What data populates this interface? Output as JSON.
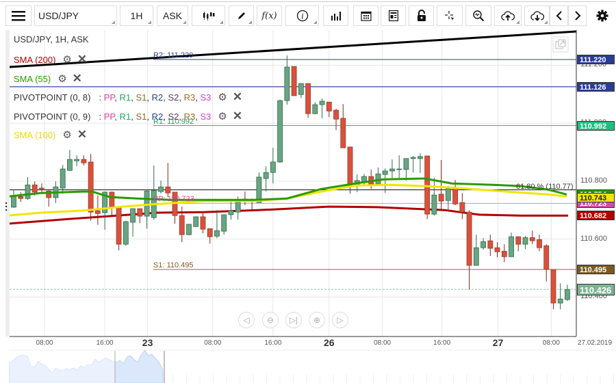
{
  "toolbar": {
    "symbol": "USD/JPY",
    "interval": "1H",
    "price_type": "ASK",
    "fx_label": "f(x)",
    "icons": [
      "hamburger-menu-icon",
      "candlestick-type-icon",
      "pencil-draw-icon",
      "function-icon",
      "info-icon",
      "bar-chart-icon",
      "calendar-icon",
      "news-icon",
      "unlock-icon",
      "crosshair-icon",
      "zoom-search-icon",
      "upload-cloud-icon",
      "download-cloud-icon",
      "chevron-left-icon",
      "chevron-right-icon",
      "gear-icon"
    ]
  },
  "legend": {
    "title": "USD/JPY, 1H, ASK",
    "sma200": "SMA (200)",
    "sma55": "SMA (55)",
    "pivot1": "PIVOTPOINT (0, 8)",
    "pivot2": "PIVOTPOINT (0, 9)",
    "sma100": "SMA (100)",
    "pivot_sep": ":",
    "pivot_parts": [
      "PP",
      "R1",
      "S1",
      "R2",
      "S2",
      "R3",
      "S3"
    ],
    "pivot_colors": [
      "#d63fa6",
      "#1aa86b",
      "#8a6d2a",
      "#2a3d8f",
      "#5a3a5a",
      "#9a6a2a",
      "#d63fd6"
    ]
  },
  "colors": {
    "up": "#6aa583",
    "down": "#d9513c",
    "sma200": "#b00000",
    "sma55": "#2b9a00",
    "sma100": "#f0e600",
    "r2": "#2a3d8f",
    "r1": "#1ec080",
    "pp": "#d68fc8",
    "s1": "#8a6d2a",
    "fib": "#333333",
    "current": "#6aa583"
  },
  "levels": {
    "r2_label": "R2: 111.220",
    "r1_label": "R1: 110.992",
    "pp_label": "PP: 110.723",
    "s1_label": "S1: 110.495",
    "fib_label": "61.80 % (110.77)"
  },
  "price_axis": {
    "badges": [
      {
        "text": "111.220",
        "value": 111.22,
        "color": "#2a3d8f"
      },
      {
        "text": "111.126",
        "value": 111.126,
        "color": "#2a3d8f"
      },
      {
        "text": "110.992",
        "value": 110.992,
        "color": "#1ec080"
      },
      {
        "text": "110.754",
        "value": 110.754,
        "color": "#2b9a00"
      },
      {
        "text": "110.723",
        "value": 110.723,
        "color": "#d04ea0"
      },
      {
        "text": "110.743",
        "value": 110.743,
        "color": "#f0e600"
      },
      {
        "text": "110.682",
        "value": 110.682,
        "color": "#b00000"
      },
      {
        "text": "110.495",
        "value": 110.495,
        "color": "#7a5a20"
      },
      {
        "text": "110.426",
        "value": 110.426,
        "color": "#7fb394"
      }
    ],
    "ticks": [
      "111.200",
      "111.000",
      "110.800",
      "110.600",
      "110.400"
    ],
    "tick_values": [
      111.2,
      111.0,
      110.8,
      110.6,
      110.4
    ]
  },
  "time_axis": {
    "labels": [
      {
        "text": "08:00",
        "index": 5.4,
        "day": false
      },
      {
        "text": "16:00",
        "index": 14.0,
        "day": false
      },
      {
        "text": "23",
        "index": 20.1,
        "day": true
      },
      {
        "text": "08:00",
        "index": 29.4,
        "day": false
      },
      {
        "text": "16:00",
        "index": 38.0,
        "day": false
      },
      {
        "text": "26",
        "index": 46.0,
        "day": true
      },
      {
        "text": "08:00",
        "index": 53.6,
        "day": false
      },
      {
        "text": "16:00",
        "index": 62.1,
        "day": false
      },
      {
        "text": "27",
        "index": 70.1,
        "day": true
      },
      {
        "text": "08:00",
        "index": 77.7,
        "day": false
      }
    ],
    "date": "27.02.2019"
  },
  "chart_data": {
    "type": "candlestick",
    "title": "USD/JPY, 1H, ASK",
    "ylim": [
      110.33,
      111.32
    ],
    "ohlc": [
      [
        110.71,
        110.771,
        110.708,
        110.747
      ],
      [
        110.747,
        110.762,
        110.728,
        110.74
      ],
      [
        110.74,
        110.814,
        110.735,
        110.787
      ],
      [
        110.787,
        110.799,
        110.75,
        110.762
      ],
      [
        110.776,
        110.792,
        110.759,
        110.775
      ],
      [
        110.766,
        110.768,
        110.712,
        110.743
      ],
      [
        110.743,
        110.799,
        110.724,
        110.78
      ],
      [
        110.776,
        110.856,
        110.757,
        110.842
      ],
      [
        110.837,
        110.908,
        110.835,
        110.875
      ],
      [
        110.87,
        110.889,
        110.851,
        110.875
      ],
      [
        110.875,
        110.889,
        110.854,
        110.863
      ],
      [
        110.866,
        110.894,
        110.663,
        110.693
      ],
      [
        110.698,
        110.75,
        110.649,
        110.688
      ],
      [
        110.691,
        110.764,
        110.632,
        110.762
      ],
      [
        110.762,
        110.764,
        110.681,
        110.708
      ],
      [
        110.71,
        110.71,
        110.561,
        110.582
      ],
      [
        110.582,
        110.663,
        110.577,
        110.66
      ],
      [
        110.658,
        110.705,
        110.608,
        110.705
      ],
      [
        110.705,
        110.705,
        110.655,
        110.679
      ],
      [
        110.679,
        110.768,
        110.636,
        110.766
      ],
      [
        110.674,
        110.854,
        110.667,
        110.768
      ],
      [
        110.764,
        110.802,
        110.757,
        110.78
      ],
      [
        110.78,
        110.863,
        110.745,
        110.759
      ],
      [
        110.762,
        110.762,
        110.653,
        110.681
      ],
      [
        110.681,
        110.712,
        110.589,
        110.615
      ],
      [
        110.615,
        110.651,
        110.613,
        110.651
      ],
      [
        110.643,
        110.677,
        110.641,
        110.677
      ],
      [
        110.677,
        110.695,
        110.62,
        110.634
      ],
      [
        110.636,
        110.636,
        110.584,
        110.608
      ],
      [
        110.61,
        110.7,
        110.603,
        110.629
      ],
      [
        110.627,
        110.684,
        110.615,
        110.684
      ],
      [
        110.684,
        110.728,
        110.667,
        110.698
      ],
      [
        110.693,
        110.747,
        110.667,
        110.728
      ],
      [
        110.738,
        110.764,
        110.717,
        110.733
      ],
      [
        110.733,
        110.74,
        110.695,
        110.731
      ],
      [
        110.726,
        110.83,
        110.726,
        110.814
      ],
      [
        110.809,
        110.851,
        110.764,
        110.83
      ],
      [
        110.83,
        110.915,
        110.792,
        110.866
      ],
      [
        110.866,
        111.082,
        110.863,
        111.078
      ],
      [
        111.078,
        111.234,
        111.064,
        111.194
      ],
      [
        111.196,
        111.196,
        111.095,
        111.095
      ],
      [
        111.099,
        111.137,
        111.087,
        111.137
      ],
      [
        111.137,
        111.137,
        111.019,
        111.033
      ],
      [
        111.033,
        111.073,
        111.031,
        111.064
      ],
      [
        111.064,
        111.085,
        111.017,
        111.076
      ],
      [
        111.073,
        111.073,
        111.021,
        111.042
      ],
      [
        111.045,
        111.05,
        110.976,
        111.014
      ],
      [
        111.017,
        111.066,
        110.915,
        110.915
      ],
      [
        110.918,
        110.918,
        110.757,
        110.783
      ],
      [
        110.787,
        110.823,
        110.762,
        110.802
      ],
      [
        110.795,
        110.825,
        110.785,
        110.816
      ],
      [
        110.816,
        110.84,
        110.773,
        110.79
      ],
      [
        110.79,
        110.847,
        110.79,
        110.825
      ],
      [
        110.823,
        110.844,
        110.759,
        110.835
      ],
      [
        110.835,
        110.875,
        110.811,
        110.842
      ],
      [
        110.84,
        110.889,
        110.811,
        110.842
      ],
      [
        110.84,
        110.878,
        110.802,
        110.878
      ],
      [
        110.878,
        110.887,
        110.83,
        110.882
      ],
      [
        110.878,
        110.896,
        110.828,
        110.885
      ],
      [
        110.887,
        110.887,
        110.669,
        110.686
      ],
      [
        110.686,
        110.811,
        110.681,
        110.752
      ],
      [
        110.755,
        110.873,
        110.702,
        110.731
      ],
      [
        110.733,
        110.783,
        110.702,
        110.774
      ],
      [
        110.774,
        110.804,
        110.717,
        110.721
      ],
      [
        110.726,
        110.759,
        110.669,
        110.693
      ],
      [
        110.693,
        110.7,
        110.426,
        110.509
      ],
      [
        110.509,
        110.615,
        110.509,
        110.57
      ],
      [
        110.57,
        110.603,
        110.563,
        110.591
      ],
      [
        110.594,
        110.615,
        110.542,
        110.568
      ],
      [
        110.57,
        110.589,
        110.537,
        110.556
      ],
      [
        110.558,
        110.582,
        110.52,
        110.539
      ],
      [
        110.539,
        110.622,
        110.539,
        110.608
      ],
      [
        110.608,
        110.608,
        110.558,
        110.582
      ],
      [
        110.582,
        110.61,
        110.565,
        110.605
      ],
      [
        110.605,
        110.629,
        110.582,
        110.594
      ],
      [
        110.598,
        110.615,
        110.558,
        110.57
      ],
      [
        110.577,
        110.582,
        110.453,
        110.495
      ],
      [
        110.495,
        110.495,
        110.357,
        110.379
      ],
      [
        110.379,
        110.447,
        110.357,
        110.393
      ],
      [
        110.391,
        110.442,
        110.386,
        110.426
      ]
    ],
    "sma200": [
      [
        0.2,
        110.653
      ],
      [
        8.8,
        110.669
      ],
      [
        21.5,
        110.691
      ],
      [
        28.3,
        110.693
      ],
      [
        38.1,
        110.702
      ],
      [
        45.9,
        110.712
      ],
      [
        52.8,
        110.71
      ],
      [
        62.5,
        110.7
      ],
      [
        67.4,
        110.684
      ],
      [
        73.3,
        110.681
      ],
      [
        80.1,
        110.681
      ]
    ],
    "sma55": [
      [
        0.2,
        110.747
      ],
      [
        4.9,
        110.759
      ],
      [
        10.8,
        110.764
      ],
      [
        12.2,
        110.764
      ],
      [
        14.7,
        110.745
      ],
      [
        18.6,
        110.74
      ],
      [
        23.5,
        110.735
      ],
      [
        28.3,
        110.735
      ],
      [
        35.2,
        110.735
      ],
      [
        40,
        110.74
      ],
      [
        44.9,
        110.773
      ],
      [
        49.8,
        110.792
      ],
      [
        53.7,
        110.806
      ],
      [
        59.6,
        110.809
      ],
      [
        63.5,
        110.792
      ],
      [
        69.4,
        110.787
      ],
      [
        73.3,
        110.783
      ],
      [
        77.2,
        110.771
      ],
      [
        79.9,
        110.754
      ]
    ],
    "sma100": [
      [
        0.2,
        110.681
      ],
      [
        4.9,
        110.691
      ],
      [
        10.8,
        110.698
      ],
      [
        16.6,
        110.712
      ],
      [
        21.5,
        110.721
      ],
      [
        28.3,
        110.731
      ],
      [
        35.2,
        110.731
      ],
      [
        40,
        110.74
      ],
      [
        44.9,
        110.764
      ],
      [
        49.8,
        110.785
      ],
      [
        54.7,
        110.787
      ],
      [
        59.6,
        110.783
      ],
      [
        65.5,
        110.774
      ],
      [
        71.3,
        110.764
      ],
      [
        77.2,
        110.754
      ],
      [
        79.9,
        110.747
      ]
    ],
    "trendline": [
      [
        0.4,
        111.194
      ],
      [
        81.4,
        111.317
      ]
    ],
    "hlines": {
      "r2": 111.22,
      "level2": 111.126,
      "r1": 110.992,
      "fib": 110.77,
      "pp": 110.723,
      "s1": 110.495,
      "current": 110.426
    }
  }
}
